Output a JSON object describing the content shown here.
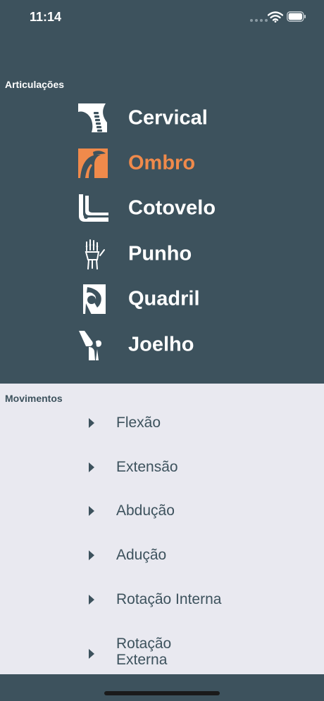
{
  "status": {
    "time": "11:14",
    "icons": [
      "cellular-dots-icon",
      "wifi-icon",
      "battery-icon"
    ]
  },
  "articulacoes": {
    "label": "Articulações",
    "items": [
      {
        "label": "Cervical",
        "icon": "cervical-spine-icon"
      },
      {
        "label": "Ombro",
        "icon": "shoulder-icon",
        "selected": true
      },
      {
        "label": "Cotovelo",
        "icon": "elbow-icon"
      },
      {
        "label": "Punho",
        "icon": "wrist-hand-icon"
      },
      {
        "label": "Quadril",
        "icon": "hip-icon"
      },
      {
        "label": "Joelho",
        "icon": "knee-icon"
      }
    ]
  },
  "movimentos": {
    "label": "Movimentos",
    "items": [
      {
        "label": "Flexão"
      },
      {
        "label": "Extensão"
      },
      {
        "label": "Abdução"
      },
      {
        "label": "Adução"
      },
      {
        "label": "Rotação Interna"
      },
      {
        "label": "Rotação",
        "label_line2": "Externa"
      }
    ]
  },
  "colors": {
    "primary": "#3d525d",
    "accent": "#f08a4b",
    "panel": "#e9e9f0"
  }
}
